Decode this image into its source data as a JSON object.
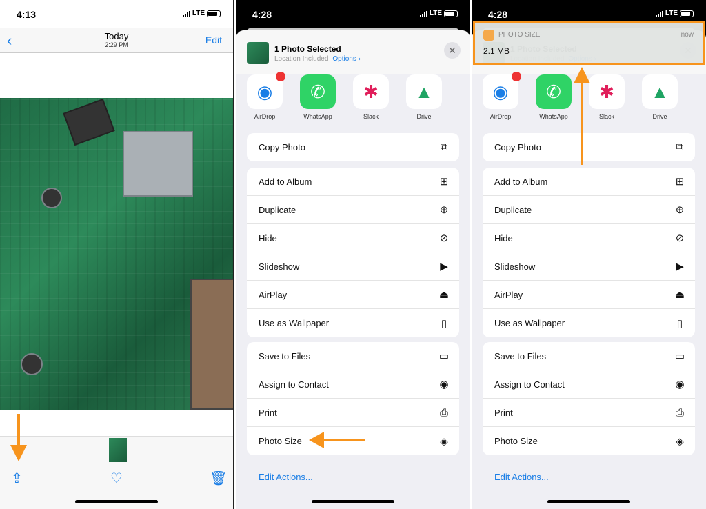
{
  "panel1": {
    "status": {
      "time": "4:13",
      "network": "LTE"
    },
    "nav": {
      "back": "‹",
      "title": "Today",
      "subtitle": "2:29 PM",
      "edit": "Edit"
    },
    "toolbar": {
      "share_icon": "share-icon",
      "heart_icon": "heart-icon",
      "trash_icon": "trash-icon"
    }
  },
  "share": {
    "status": {
      "time": "4:28",
      "network": "LTE"
    },
    "title": "1 Photo Selected",
    "location": "Location Included",
    "options": "Options ›",
    "close": "✕",
    "apps": [
      {
        "label": "AirDrop",
        "icon": "airdrop-icon",
        "badge": true
      },
      {
        "label": "WhatsApp",
        "icon": "whatsapp-icon"
      },
      {
        "label": "Slack",
        "icon": "slack-icon"
      },
      {
        "label": "Drive",
        "icon": "drive-icon"
      }
    ],
    "groups": [
      [
        {
          "label": "Copy Photo",
          "icon": "copy-icon"
        }
      ],
      [
        {
          "label": "Add to Album",
          "icon": "add-album-icon"
        },
        {
          "label": "Duplicate",
          "icon": "duplicate-icon"
        },
        {
          "label": "Hide",
          "icon": "eye-slash-icon"
        },
        {
          "label": "Slideshow",
          "icon": "play-icon"
        },
        {
          "label": "AirPlay",
          "icon": "airplay-icon"
        },
        {
          "label": "Use as Wallpaper",
          "icon": "phone-icon"
        }
      ],
      [
        {
          "label": "Save to Files",
          "icon": "folder-icon"
        },
        {
          "label": "Assign to Contact",
          "icon": "contact-icon"
        },
        {
          "label": "Print",
          "icon": "printer-icon"
        },
        {
          "label": "Photo Size",
          "icon": "layers-icon"
        }
      ]
    ],
    "edit_actions": "Edit Actions..."
  },
  "notification": {
    "app": "PHOTO SIZE",
    "time": "now",
    "body": "2.1 MB"
  },
  "colors": {
    "accent": "#1a7ee6",
    "annotation": "#f7941d"
  }
}
